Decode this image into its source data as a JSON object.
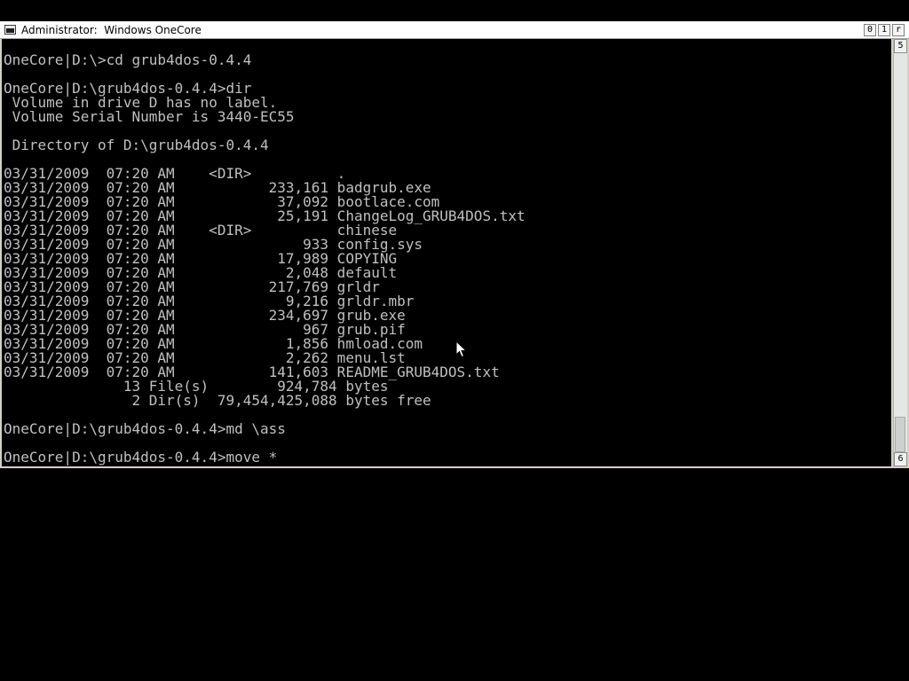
{
  "window": {
    "title": "Administrator:  Windows OneCore",
    "buttons": [
      "0",
      "1",
      "r"
    ]
  },
  "console": {
    "lines": [
      "OneCore|D:\\>cd grub4dos-0.4.4",
      "",
      "OneCore|D:\\grub4dos-0.4.4>dir",
      " Volume in drive D has no label.",
      " Volume Serial Number is 3440-EC55",
      "",
      " Directory of D:\\grub4dos-0.4.4",
      "",
      "03/31/2009  07:20 AM    <DIR>          .",
      "03/31/2009  07:20 AM           233,161 badgrub.exe",
      "03/31/2009  07:20 AM            37,092 bootlace.com",
      "03/31/2009  07:20 AM            25,191 ChangeLog_GRUB4DOS.txt",
      "03/31/2009  07:20 AM    <DIR>          chinese",
      "03/31/2009  07:20 AM               933 config.sys",
      "03/31/2009  07:20 AM            17,989 COPYING",
      "03/31/2009  07:20 AM             2,048 default",
      "03/31/2009  07:20 AM           217,769 grldr",
      "03/31/2009  07:20 AM             9,216 grldr.mbr",
      "03/31/2009  07:20 AM           234,697 grub.exe",
      "03/31/2009  07:20 AM               967 grub.pif",
      "03/31/2009  07:20 AM             1,856 hmload.com",
      "03/31/2009  07:20 AM             2,262 menu.lst",
      "03/31/2009  07:20 AM           141,603 README_GRUB4DOS.txt",
      "              13 File(s)        924,784 bytes",
      "               2 Dir(s)  79,454,425,088 bytes free",
      "",
      "OneCore|D:\\grub4dos-0.4.4>md \\ass",
      "",
      "OneCore|D:\\grub4dos-0.4.4>move *"
    ]
  },
  "scrollbar": {
    "up_glyph": "5",
    "down_glyph": "6",
    "position_fraction": 1.0
  },
  "colors": {
    "console_background": "#000000",
    "console_text": "#c0c0c0",
    "titlebar_background": "#ffffff"
  }
}
